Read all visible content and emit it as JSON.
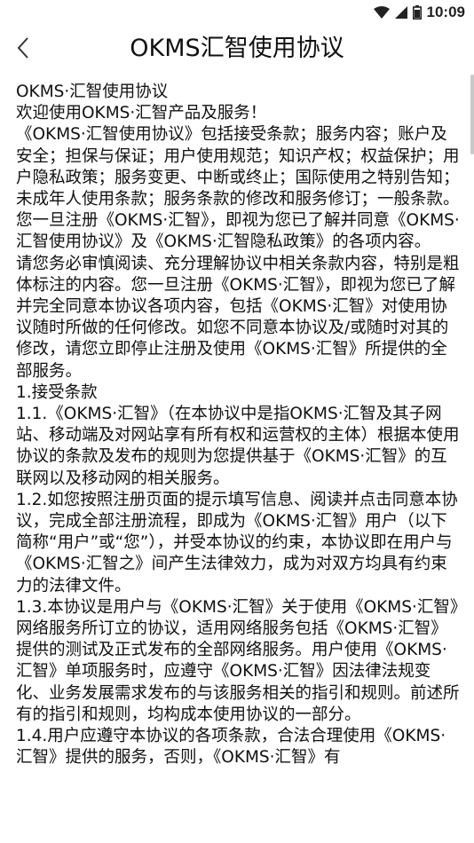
{
  "status_bar": {
    "time": "10:09",
    "icons": [
      "wifi-icon",
      "signal-icon",
      "battery-icon"
    ]
  },
  "header": {
    "back_icon": "chevron-left-icon",
    "title": "OKMS汇智使用协议"
  },
  "content": {
    "paragraphs": [
      "OKMS·汇智使用协议",
      "欢迎使用OKMS·汇智产品及服务！",
      "《OKMS·汇智使用协议》包括接受条款；服务内容；账户及安全；担保与保证；用户使用规范；知识产权；权益保护；用户隐私政策；服务变更、中断或终止；国际使用之特别告知；未成年人使用条款；服务条款的修改和服务修订；一般条款。",
      "您一旦注册《OKMS·汇智》，即视为您已了解并同意《OKMS·汇智使用协议》及《OKMS·汇智隐私政策》的各项内容。",
      "请您务必审慎阅读、充分理解协议中相关条款内容，特别是粗体标注的内容。您一旦注册《OKMS·汇智》，即视为您已了解并完全同意本协议各项内容，包括《OKMS·汇智》对使用协议随时所做的任何修改。如您不同意本协议及/或随时对其的修改，请您立即停止注册及使用《OKMS·汇智》所提供的全部服务。",
      "1.接受条款",
      "1.1.《OKMS·汇智》（在本协议中是指OKMS·汇智及其子网站、移动端及对网站享有所有权和运营权的主体）根据本使用协议的条款及发布的规则为您提供基于《OKMS·汇智》的互联网以及移动网的相关服务。",
      "1.2.如您按照注册页面的提示填写信息、阅读并点击同意本协议，完成全部注册流程，即成为《OKMS·汇智》用户（以下简称“用户”或“您”），并受本协议的约束，本协议即在用户与《OKMS·汇智之》间产生法律效力，成为对双方均具有约束力的法律文件。",
      "1.3.本协议是用户与《OKMS·汇智》关于使用《OKMS·汇智》网络服务所订立的协议，适用网络服务包括《OKMS·汇智》提供的测试及正式发布的全部网络服务。用户使用《OKMS·汇智》单项服务时，应遵守《OKMS·汇智》因法律法规变化、业务发展需求发布的与该服务相关的指引和规则。前述所有的指引和规则，均构成本使用协议的一部分。",
      "1.4.用户应遵守本协议的各项条款，合法合理使用《OKMS·汇智》提供的服务，否则，《OKMS·汇智》有"
    ]
  }
}
